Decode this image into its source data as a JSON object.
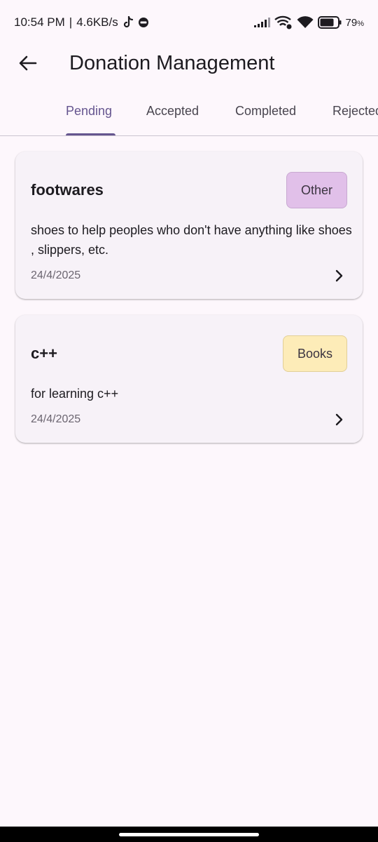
{
  "status_bar": {
    "time": "10:54 PM",
    "separator": "|",
    "network_speed": "4.6KB/s",
    "battery_percent": "79",
    "battery_unit": "%",
    "battery_level": 0.79
  },
  "app_bar": {
    "title": "Donation Management",
    "back_icon": "arrow-back-icon"
  },
  "tabs": [
    {
      "label": "Pending",
      "active": true
    },
    {
      "label": "Accepted",
      "active": false
    },
    {
      "label": "Completed",
      "active": false
    },
    {
      "label": "Rejected",
      "active": false
    }
  ],
  "donations": [
    {
      "title": "footwares",
      "category": "Other",
      "category_color": "#e1c0e9",
      "category_border": "#c8a9d1",
      "description": "shoes to help peoples who don't have anything like shoes , slippers, etc.",
      "date": "24/4/2025"
    },
    {
      "title": "c++",
      "category": "Books",
      "category_color": "#fdecb8",
      "category_border": "#e2cf98",
      "description": "for learning c++",
      "date": "24/4/2025"
    }
  ],
  "colors": {
    "background": "#fdf7fc",
    "accent": "#65558f",
    "card": "#f7f2f8"
  }
}
